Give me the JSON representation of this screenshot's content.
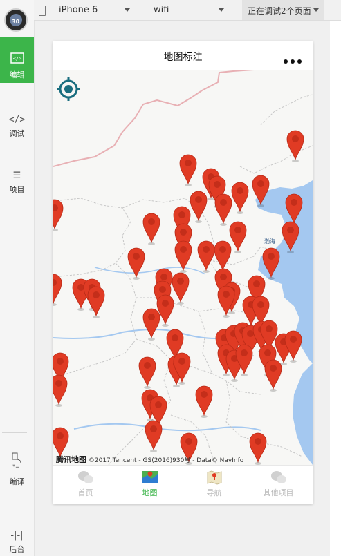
{
  "sidebar": {
    "avatar_number": "30",
    "items": [
      {
        "label": "编辑",
        "icon": "code-box-icon",
        "active": true
      },
      {
        "label": "调试",
        "icon": "code-icon",
        "active": false
      },
      {
        "label": "项目",
        "icon": "menu-icon",
        "active": false
      },
      {
        "label": "编译",
        "icon": "compile-icon",
        "active": false
      },
      {
        "label": "后台",
        "icon": "backend-icon",
        "active": false
      }
    ]
  },
  "toolbar": {
    "device": "iPhone 6",
    "network": "wifi",
    "debug_label": "正在调试2个页面"
  },
  "page": {
    "title": "地图标注",
    "map_copyright": "©2017 Tencent - GS(2016)930号 - Data© NavInfo",
    "map_logo": "腾讯地图",
    "sea_label": "渤海"
  },
  "tabbar": [
    {
      "label": "首页",
      "icon": "wechat-icon",
      "active": false
    },
    {
      "label": "地图",
      "icon": "map-icon",
      "active": true
    },
    {
      "label": "导航",
      "icon": "navigation-map-icon",
      "active": false
    },
    {
      "label": "其他项目",
      "icon": "wechat-icon",
      "active": false
    }
  ],
  "colors": {
    "accent_green": "#3cb54a",
    "marker_red": "#e03b24",
    "locate_teal": "#1a6e7f",
    "water_blue": "#a4c8f0"
  }
}
